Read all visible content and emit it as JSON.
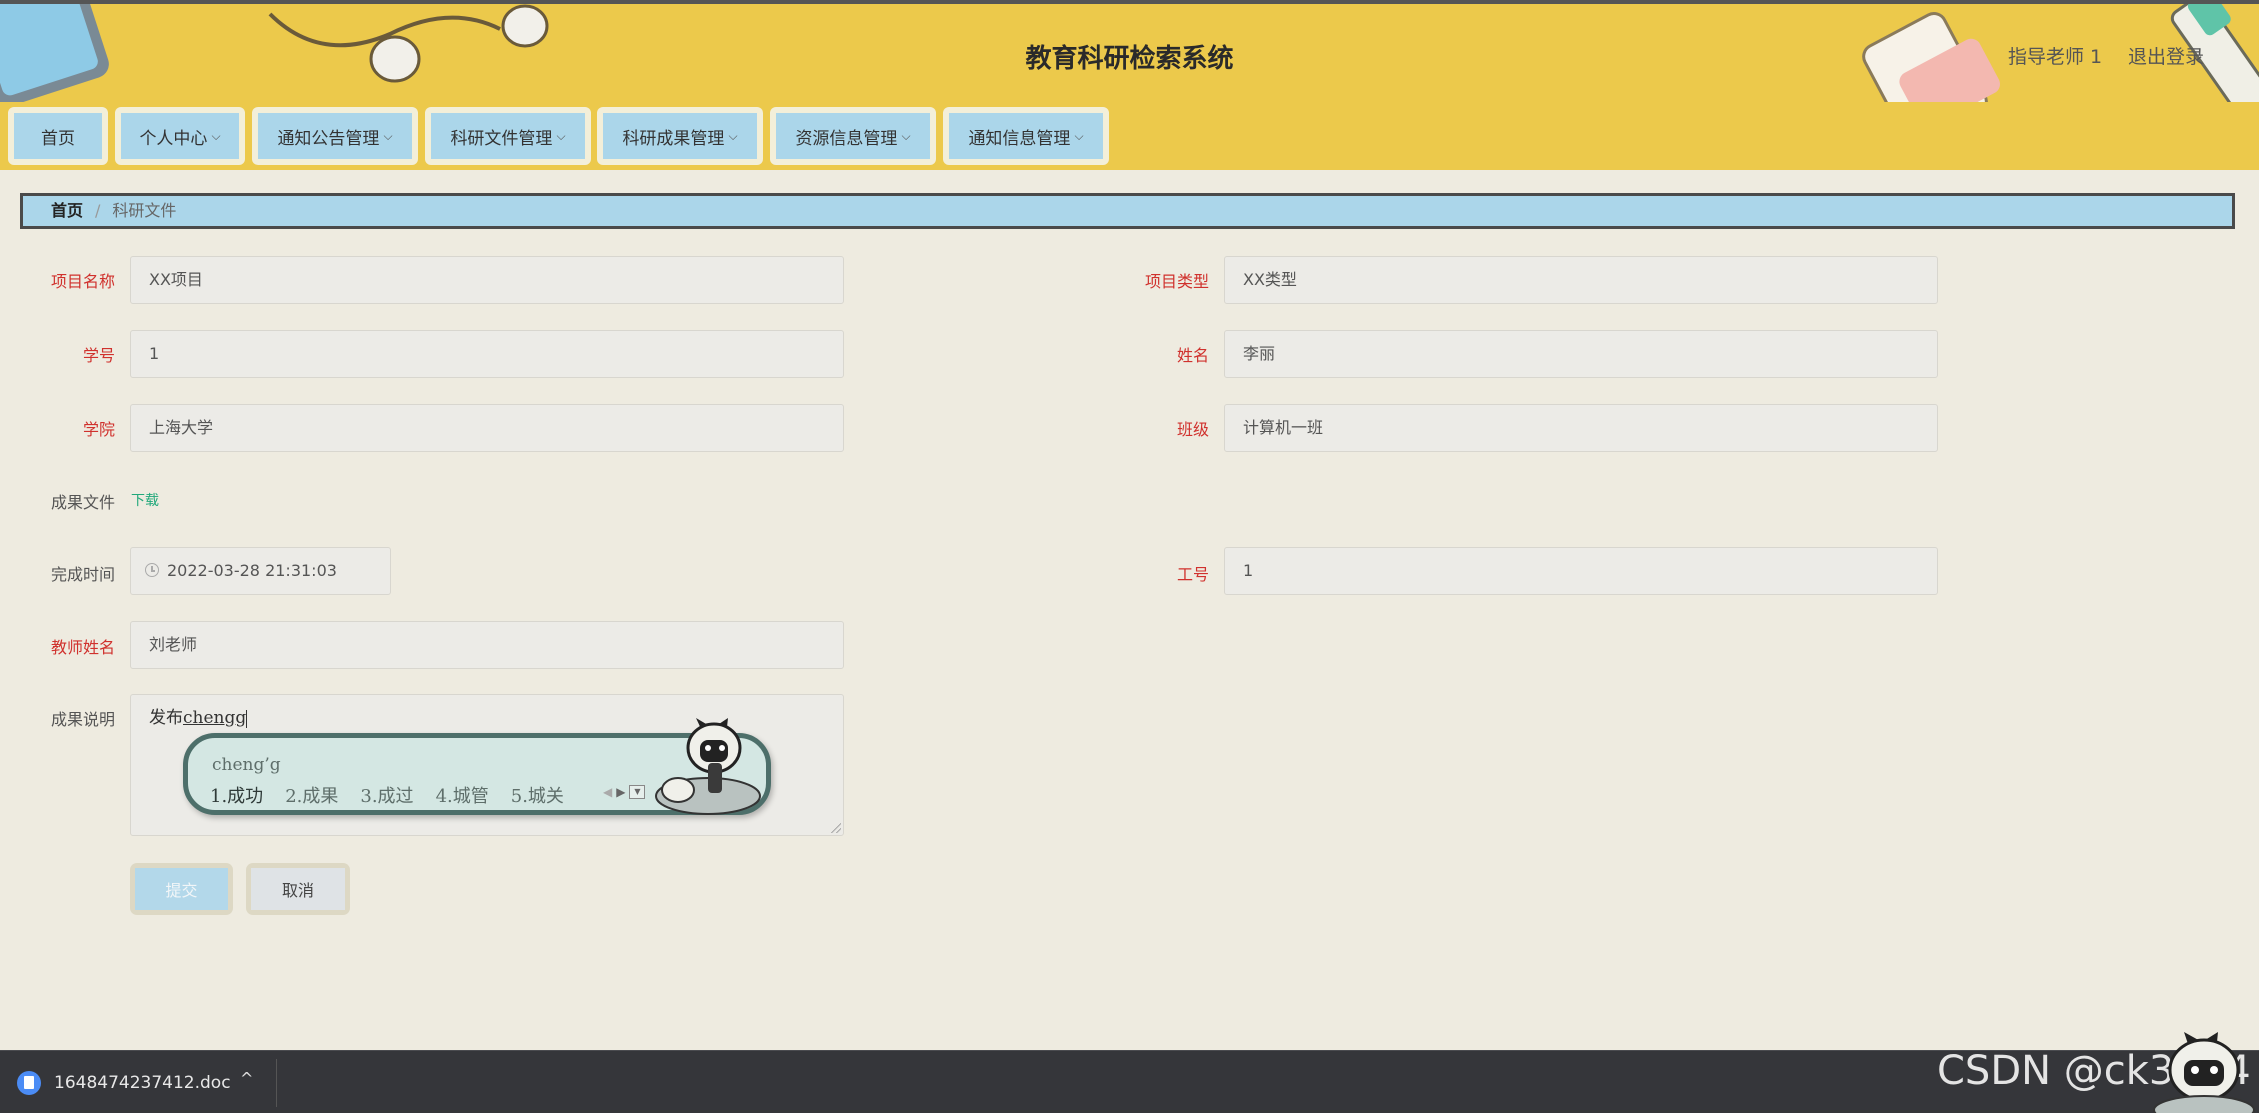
{
  "header": {
    "title": "教育科研检索系统",
    "user": "指导老师 1",
    "logout": "退出登录"
  },
  "nav": {
    "items": [
      {
        "label": "首页",
        "dropdown": false
      },
      {
        "label": "个人中心",
        "dropdown": true
      },
      {
        "label": "通知公告管理",
        "dropdown": true
      },
      {
        "label": "科研文件管理",
        "dropdown": true
      },
      {
        "label": "科研成果管理",
        "dropdown": true
      },
      {
        "label": "资源信息管理",
        "dropdown": true
      },
      {
        "label": "通知信息管理",
        "dropdown": true
      }
    ]
  },
  "breadcrumb": {
    "home": "首页",
    "separator": "/",
    "current": "科研文件"
  },
  "form": {
    "project_name": {
      "label": "项目名称",
      "value": "XX项目"
    },
    "project_type": {
      "label": "项目类型",
      "value": "XX类型"
    },
    "student_id": {
      "label": "学号",
      "value": "1"
    },
    "student_name": {
      "label": "姓名",
      "value": "李丽"
    },
    "college": {
      "label": "学院",
      "value": "上海大学"
    },
    "class_name": {
      "label": "班级",
      "value": "计算机一班"
    },
    "result_file": {
      "label": "成果文件",
      "link": "下载"
    },
    "complete_time": {
      "label": "完成时间",
      "value": "2022-03-28 21:31:03"
    },
    "staff_id": {
      "label": "工号",
      "value": "1"
    },
    "teacher_name": {
      "label": "教师姓名",
      "value": "刘老师"
    },
    "result_desc": {
      "label": "成果说明",
      "text": "发布",
      "composing": "chengg"
    }
  },
  "ime": {
    "composition": "cheng’g",
    "candidates": [
      "1.成功",
      "2.成果",
      "3.成过",
      "4.城管",
      "5.城关"
    ]
  },
  "buttons": {
    "submit": "提交",
    "cancel": "取消"
  },
  "download_bar": {
    "file_name": "1648474237412.doc",
    "chevron": "^"
  },
  "watermark": "CSDN @ck3024",
  "colors": {
    "header_bg": "#ecc94b",
    "nav_item_bg": "#abd6ea",
    "page_bg": "#eeebe0",
    "required_label": "#d0312d",
    "download_link": "#20a87a"
  }
}
